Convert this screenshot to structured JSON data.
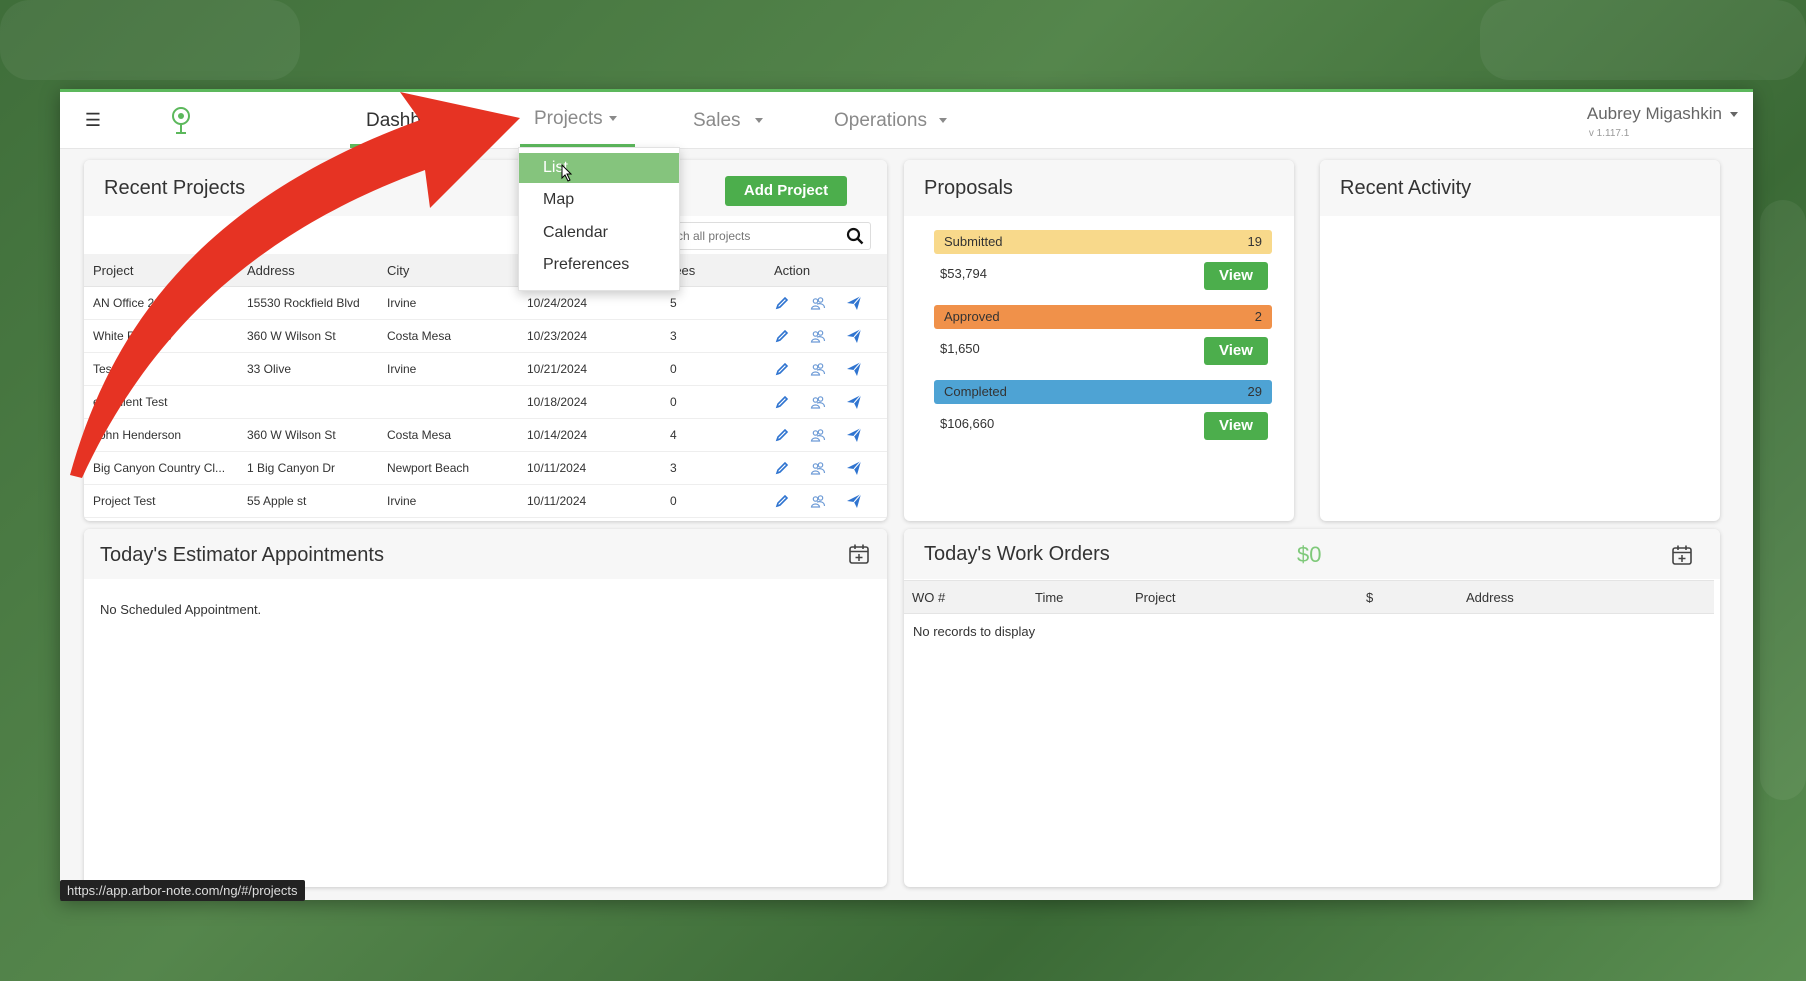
{
  "nav": {
    "menu_icon": "menu-icon",
    "logo_icon": "tree-logo-icon",
    "items": [
      {
        "label": "Dashboard"
      },
      {
        "label": "Projects"
      },
      {
        "label": "Sales"
      },
      {
        "label": "Operations"
      }
    ],
    "user_name": "Aubrey Migashkin",
    "version": "v 1.117.1"
  },
  "projects_menu": {
    "items": [
      "List",
      "Map",
      "Calendar",
      "Preferences"
    ],
    "selected": "List"
  },
  "recent_projects": {
    "title": "Recent Projects",
    "add_button": "Add Project",
    "search_placeholder": "rch all projects",
    "columns": [
      "Project",
      "Address",
      "City",
      "",
      "rees",
      "Action"
    ],
    "rows": [
      {
        "project": "AN Office 20",
        "address": "15530 Rockfield Blvd",
        "city": "Irvine",
        "date": "10/24/2024",
        "trees": "5"
      },
      {
        "project": "White R     dence",
        "address": "360 W Wilson St",
        "city": "Costa Mesa",
        "date": "10/23/2024",
        "trees": "3"
      },
      {
        "project": "Tes",
        "address": "33 Olive",
        "city": "Irvine",
        "date": "10/21/2024",
        "trees": "0"
      },
      {
        "project": "ew Client Test",
        "address": "",
        "city": "",
        "date": "10/18/2024",
        "trees": "0"
      },
      {
        "project": "John Henderson",
        "address": "360 W Wilson St",
        "city": "Costa Mesa",
        "date": "10/14/2024",
        "trees": "4"
      },
      {
        "project": "Big Canyon Country Cl...",
        "address": "1 Big Canyon Dr",
        "city": "Newport Beach",
        "date": "10/11/2024",
        "trees": "3"
      },
      {
        "project": "Project Test",
        "address": "55 Apple st",
        "city": "Irvine",
        "date": "10/11/2024",
        "trees": "0"
      }
    ]
  },
  "proposals": {
    "title": "Proposals",
    "items": [
      {
        "label": "Submitted",
        "count": "19",
        "amount": "$53,794",
        "button": "View",
        "color": "#f8d98b"
      },
      {
        "label": "Approved",
        "count": "2",
        "amount": "$1,650",
        "button": "View",
        "color": "#f0914a"
      },
      {
        "label": "Completed",
        "count": "29",
        "amount": "$106,660",
        "button": "View",
        "color": "#4ea3d4"
      }
    ]
  },
  "recent_activity": {
    "title": "Recent Activity"
  },
  "estimator": {
    "title": "Today's Estimator Appointments",
    "empty": "No Scheduled Appointment."
  },
  "work_orders": {
    "title": "Today's Work Orders",
    "total": "$0",
    "columns": [
      "WO #",
      "Time",
      "Project",
      "$",
      "Address"
    ],
    "empty": "No records to display"
  },
  "status_url": "https://app.arbor-note.com/ng/#/projects",
  "colors": {
    "accent": "#5cb85c",
    "button": "#4cae4c",
    "annotation_arrow": "#e63323"
  }
}
